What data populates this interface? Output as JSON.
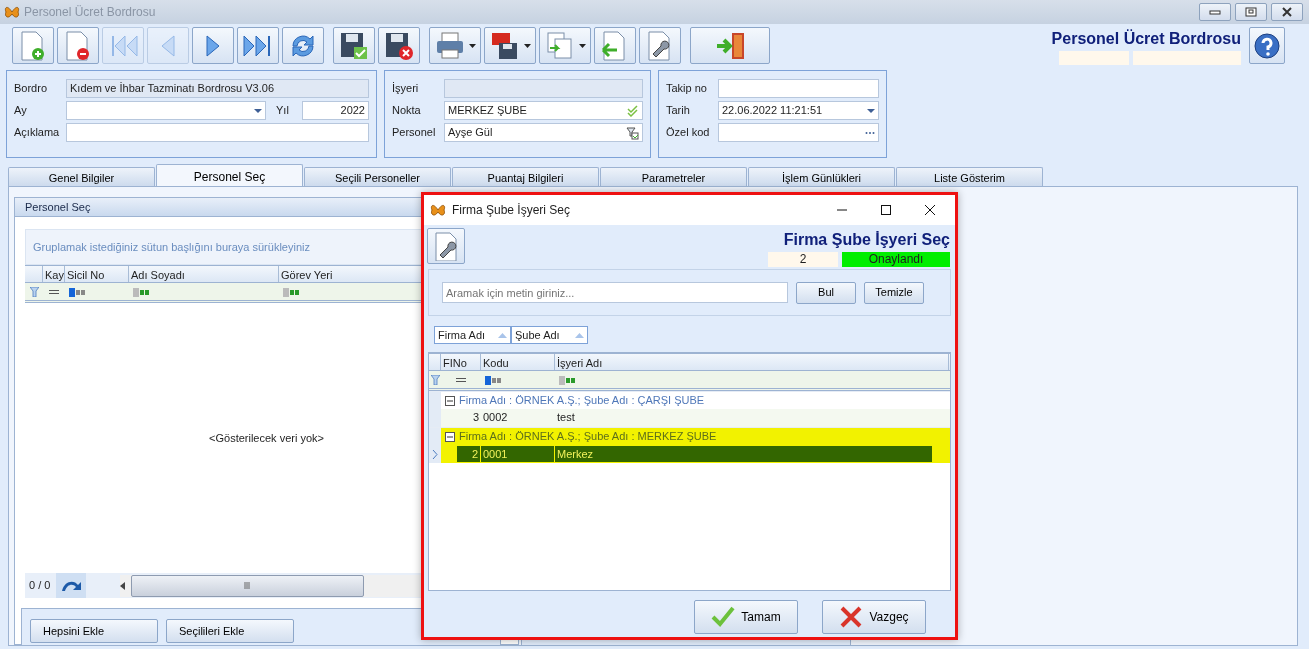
{
  "window": {
    "title": "Personel Ücret Bordrosu"
  },
  "toolbar": [
    {
      "kind": "new",
      "disabled": false,
      "has_menu": false
    },
    {
      "kind": "delete",
      "disabled": false,
      "has_menu": false
    },
    {
      "kind": "first",
      "disabled": true,
      "has_menu": false
    },
    {
      "kind": "prev",
      "disabled": true,
      "has_menu": false
    },
    {
      "kind": "next",
      "disabled": false,
      "has_menu": false
    },
    {
      "kind": "last",
      "disabled": false,
      "has_menu": false
    },
    {
      "kind": "refresh",
      "disabled": false,
      "has_menu": false
    },
    {
      "kind": "save",
      "disabled": false,
      "has_menu": false
    },
    {
      "kind": "cancel",
      "disabled": false,
      "has_menu": false
    },
    {
      "kind": "print",
      "disabled": false,
      "has_menu": true
    },
    {
      "kind": "pdf",
      "disabled": false,
      "has_menu": true
    },
    {
      "kind": "copy",
      "disabled": false,
      "has_menu": true
    },
    {
      "kind": "import",
      "disabled": false,
      "has_menu": false
    },
    {
      "kind": "settings",
      "disabled": false,
      "has_menu": false
    },
    {
      "kind": "exit",
      "disabled": false,
      "has_menu": false
    }
  ],
  "header": {
    "title": "Personel Ücret Bordrosu"
  },
  "form_groups": [
    {
      "fields": [
        {
          "label": "Bordro",
          "value": "Kıdem ve İhbar Tazminatı Bordrosu V3.06",
          "kind": "text",
          "readonly": true
        },
        {
          "label": "Ay",
          "kind": "dropdown",
          "readonly": false,
          "side_label": "Yıl",
          "side_value": "2022"
        },
        {
          "label": "Açıklama",
          "kind": "text",
          "readonly": false
        }
      ]
    },
    {
      "fields": [
        {
          "label": "İşyeri",
          "kind": "text",
          "readonly": true
        },
        {
          "label": "Nokta",
          "value": "MERKEZ ŞUBE",
          "kind": "check",
          "readonly": false
        },
        {
          "label": "Personel",
          "value": "Ayşe Gül",
          "kind": "lookup",
          "readonly": false
        }
      ]
    },
    {
      "fields": [
        {
          "label": "Takip no",
          "kind": "text",
          "readonly": false
        },
        {
          "label": "Tarih",
          "value": "22.06.2022 11:21:51",
          "kind": "dropdown",
          "readonly": false
        },
        {
          "label": "Özel kod",
          "kind": "ellipsis",
          "readonly": false
        }
      ]
    }
  ],
  "tabs": [
    {
      "label": "Genel Bilgiler",
      "selected": false
    },
    {
      "label": "Personel Seç",
      "selected": true
    },
    {
      "label": "Seçili Personeller",
      "selected": false
    },
    {
      "label": "Puantaj Bilgileri",
      "selected": false
    },
    {
      "label": "Parametreler",
      "selected": false
    },
    {
      "label": "İşlem Günlükleri",
      "selected": false
    },
    {
      "label": "Liste Gösterim",
      "selected": false
    }
  ],
  "panel": {
    "title": "Personel Seç",
    "group_hint": "Gruplamak istediğiniz sütun başlığını buraya sürükleyiniz",
    "columns": [
      "Kay",
      "Sicil No",
      "Adı Soyadı",
      "Görev Yeri"
    ],
    "empty_text": "<Gösterilecek veri yok>",
    "pager": "0 / 0",
    "buttons": [
      "Hepsini Ekle",
      "Seçilileri Ekle"
    ]
  },
  "dialog": {
    "title": "Firma Şube İşyeri Seç",
    "header_title": "Firma Şube İşyeri Seç",
    "count": "2",
    "status": "Onaylandı",
    "search": {
      "placeholder": "Aramak için metin giriniz..."
    },
    "search_buttons": [
      "Bul",
      "Temizle"
    ],
    "group_by": [
      "Firma Adı",
      "Şube Adı"
    ],
    "columns": [
      "FINo",
      "Kodu",
      "İşyeri Adı"
    ],
    "groups": [
      {
        "label": "Firma Adı : ÖRNEK A.Ş.;  Şube Adı : ÇARŞI ŞUBE",
        "expanded": true,
        "rows": [
          {
            "fino": "3",
            "kodu": "0002",
            "name": "test",
            "selected": false
          }
        ]
      },
      {
        "label": "Firma Adı : ÖRNEK A.Ş.;  Şube Adı : MERKEZ ŞUBE",
        "expanded": true,
        "rows": [
          {
            "fino": "2",
            "kodu": "0001",
            "name": "Merkez",
            "selected": true
          }
        ]
      }
    ],
    "buttons": [
      {
        "label": "Tamam",
        "kind": "ok"
      },
      {
        "label": "Vazgeç",
        "kind": "cancel"
      }
    ]
  }
}
